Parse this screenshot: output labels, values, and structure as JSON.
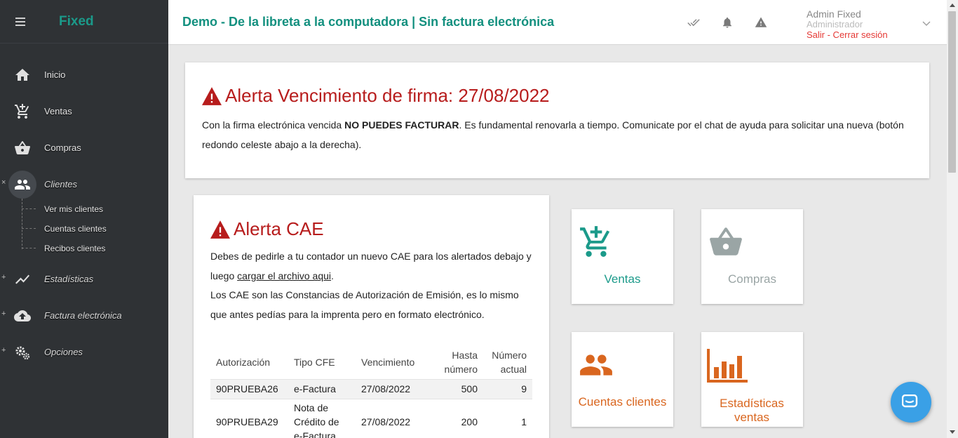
{
  "app": {
    "brand": "Fixed"
  },
  "sidebar": {
    "items": [
      {
        "label": "Inicio",
        "icon": "home-icon",
        "marker": ""
      },
      {
        "label": "Ventas",
        "icon": "cart-add-icon",
        "marker": ""
      },
      {
        "label": "Compras",
        "icon": "basket-icon",
        "marker": ""
      },
      {
        "label": "Clientes",
        "icon": "people-icon",
        "marker": "×"
      },
      {
        "label": "Estadísticas",
        "icon": "chart-line-icon",
        "marker": "+"
      },
      {
        "label": "Factura electrónica",
        "icon": "cloud-upload-icon",
        "marker": "+"
      },
      {
        "label": "Opciones",
        "icon": "gears-icon",
        "marker": "+"
      }
    ],
    "clientes_sub": [
      {
        "label": "Ver mis clientes"
      },
      {
        "label": "Cuentas clientes"
      },
      {
        "label": "Recibos clientes"
      }
    ]
  },
  "header": {
    "title": "Demo - De la libreta a la computadora | Sin factura electrónica",
    "user_name": "Admin Fixed",
    "user_role": "Administrador",
    "logout": "Salir - Cerrar sesión"
  },
  "alert_firma": {
    "title": "Alerta Vencimiento de firma: 27/08/2022",
    "text_before": "Con la firma electrónica vencida ",
    "text_bold": "NO PUEDES FACTURAR",
    "text_after": ". Es fundamental renovarla a tiempo. Comunicate por el chat de ayuda para solicitar una nueva (botón redondo celeste abajo a la derecha)."
  },
  "alert_cae": {
    "title": "Alerta CAE",
    "p1_before": "Debes de pedirle a tu contador un nuevo CAE para los alertados debajo y luego ",
    "p1_link": "cargar el archivo aqui",
    "p1_after": ".",
    "p2": "Los CAE son las Constancias de Autorización de Emisión, es lo mismo que antes pedías para la imprenta pero en formato electrónico.",
    "columns": [
      "Autorización",
      "Tipo CFE",
      "Vencimiento",
      "Hasta número",
      "Número actual"
    ],
    "rows": [
      [
        "90PRUEBA26",
        "e-Factura",
        "27/08/2022",
        "500",
        "9"
      ],
      [
        "90PRUEBA29",
        "Nota de Crédito de e-Factura",
        "27/08/2022",
        "200",
        "1"
      ]
    ]
  },
  "tiles": {
    "ventas": {
      "label": "Ventas",
      "color": "#1b9a8a"
    },
    "compras": {
      "label": "Compras",
      "color": "#9aa5a5"
    },
    "cuentas": {
      "label": "Cuentas clientes",
      "color": "#d9661f"
    },
    "estadisticas": {
      "label": "Estadísticas ventas",
      "color": "#d9661f"
    }
  },
  "colors": {
    "accent": "#13907f",
    "alert": "#b71c1c",
    "sidebar": "#2f3235",
    "logout": "#e53935",
    "chat": "#3aa0e6"
  }
}
